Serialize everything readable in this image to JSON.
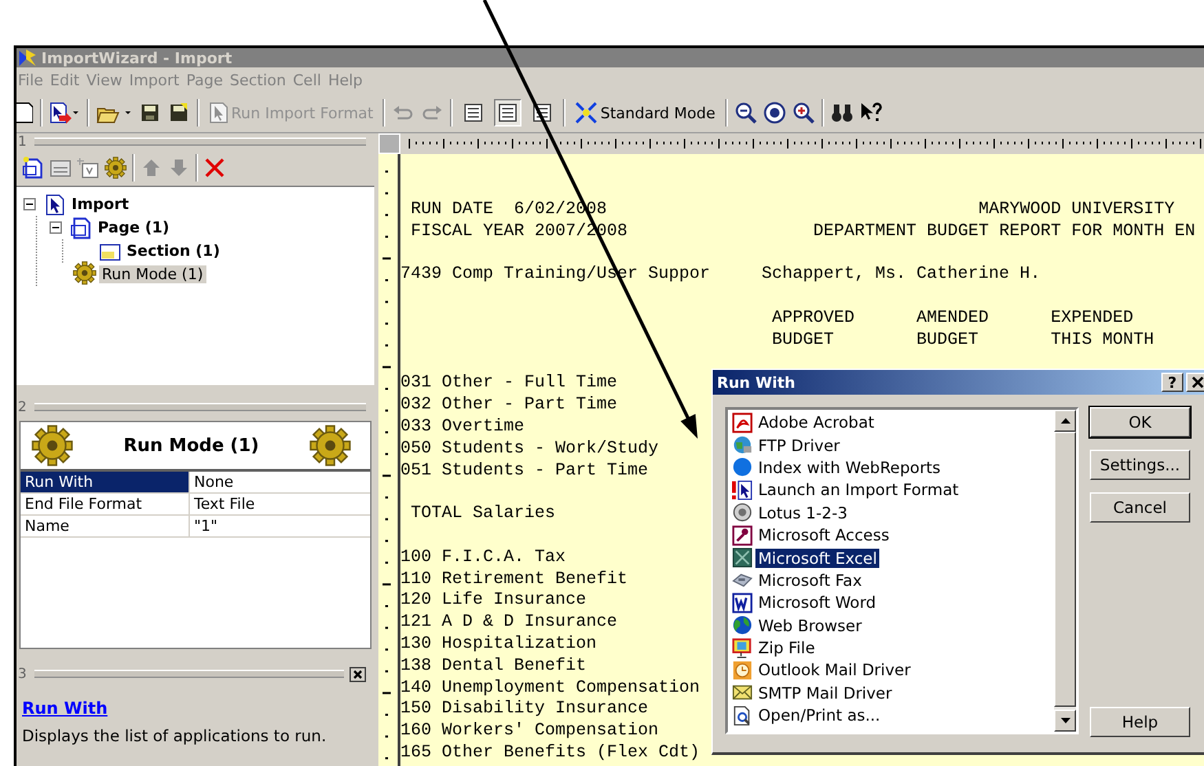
{
  "window": {
    "title": "ImportWizard - Import"
  },
  "menu": [
    "File",
    "Edit",
    "View",
    "Import",
    "Page",
    "Section",
    "Cell",
    "Help"
  ],
  "toolbar": {
    "run_import": {
      "label": "Run Import Format",
      "disabled": true
    },
    "views": [
      {
        "selected": false
      },
      {
        "selected": true
      },
      {
        "selected": false
      }
    ],
    "standard_mode": {
      "label": "Standard Mode"
    }
  },
  "panel_1": {
    "number": "1",
    "tree": [
      {
        "kind": "import",
        "label": "Import",
        "expanded": true,
        "selected": false,
        "children": [
          {
            "kind": "page",
            "label": "Page (1)",
            "expanded": true,
            "selected": false,
            "children": [
              {
                "kind": "section",
                "label": "Section (1)",
                "selected": false
              }
            ]
          },
          {
            "kind": "runmode",
            "label": "Run Mode (1)",
            "selected": true
          }
        ]
      }
    ]
  },
  "panel_2": {
    "number": "2",
    "title": "Run Mode (1)",
    "properties": [
      {
        "name": "Run With",
        "value": "None",
        "selected": true
      },
      {
        "name": "End File Format",
        "value": "Text File",
        "selected": false
      },
      {
        "name": "Name",
        "value": "\"1\"",
        "selected": false
      }
    ]
  },
  "panel_3": {
    "number": "3",
    "link": "Run With",
    "description": "Displays the list of applications to run."
  },
  "report": {
    "run_date": "RUN DATE  6/02/2008",
    "org": "MARYWOOD UNIVERSITY",
    "fiscal_year": "FISCAL YEAR 2007/2008",
    "title": "DEPARTMENT BUDGET REPORT FOR MONTH EN",
    "account": "7439 Comp Training/User Suppor",
    "manager": "Schappert, Ms. Catherine H.",
    "columns": [
      {
        "line1": "APPROVED",
        "line2": "BUDGET"
      },
      {
        "line1": "AMENDED",
        "line2": "BUDGET"
      },
      {
        "line1": "EXPENDED",
        "line2": "THIS MONTH"
      }
    ],
    "lines": [
      {
        "kind": "item",
        "text": "031 Other - Full Time"
      },
      {
        "kind": "item",
        "text": "032 Other - Part Time"
      },
      {
        "kind": "item",
        "text": "033 Overtime"
      },
      {
        "kind": "item",
        "text": "050 Students - Work/Study"
      },
      {
        "kind": "item",
        "text": "051 Students - Part Time"
      },
      {
        "kind": "total",
        "text": "TOTAL Salaries"
      },
      {
        "kind": "item",
        "text": "100 F.I.C.A. Tax"
      },
      {
        "kind": "item",
        "text": "110 Retirement Benefit"
      },
      {
        "kind": "item",
        "text": "120 Life Insurance"
      },
      {
        "kind": "item",
        "text": "121 A D & D Insurance"
      },
      {
        "kind": "item",
        "text": "130 Hospitalization"
      },
      {
        "kind": "item",
        "text": "138 Dental Benefit"
      },
      {
        "kind": "item",
        "text": "140 Unemployment Compensation"
      },
      {
        "kind": "item",
        "text": "150 Disability Insurance"
      },
      {
        "kind": "item",
        "text": "160 Workers' Compensation"
      },
      {
        "kind": "item",
        "text": "165 Other Benefits (Flex Cdt)"
      }
    ]
  },
  "dialog": {
    "title": "Run With",
    "help": "?",
    "items": [
      {
        "kind": "pdf",
        "label": "Adobe Acrobat",
        "selected": false
      },
      {
        "kind": "ftp",
        "label": "FTP Driver",
        "selected": false
      },
      {
        "kind": "web",
        "label": "Index with WebReports",
        "selected": false
      },
      {
        "kind": "launch",
        "label": "Launch an Import Format",
        "selected": false
      },
      {
        "kind": "lotus",
        "label": "Lotus 1-2-3",
        "selected": false
      },
      {
        "kind": "access",
        "label": "Microsoft Access",
        "selected": false
      },
      {
        "kind": "excel",
        "label": "Microsoft Excel",
        "selected": true
      },
      {
        "kind": "fax",
        "label": "Microsoft Fax",
        "selected": false
      },
      {
        "kind": "word",
        "label": "Microsoft Word",
        "selected": false
      },
      {
        "kind": "browser",
        "label": "Web Browser",
        "selected": false
      },
      {
        "kind": "zip",
        "label": "Zip File",
        "selected": false
      },
      {
        "kind": "outlook",
        "label": "Outlook Mail Driver",
        "selected": false
      },
      {
        "kind": "smtp",
        "label": "SMTP Mail Driver",
        "selected": false
      },
      {
        "kind": "print",
        "label": "Open/Print as...",
        "selected": false
      }
    ],
    "buttons": [
      "OK",
      "Settings...",
      "Cancel",
      "Help"
    ]
  }
}
